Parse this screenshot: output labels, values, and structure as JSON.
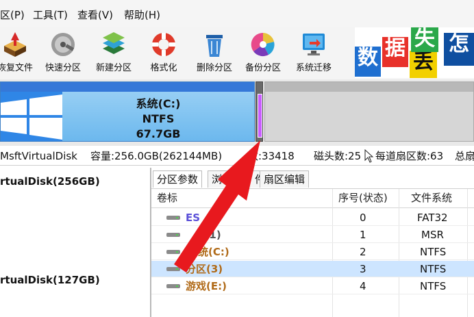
{
  "menu": {
    "items": [
      "区(P)",
      "工具(T)",
      "查看(V)",
      "帮助(H)"
    ]
  },
  "toolbar": {
    "items": [
      {
        "label": "恢复文件",
        "icon": "recover-icon"
      },
      {
        "label": "快速分区",
        "icon": "disk-icon"
      },
      {
        "label": "新建分区",
        "icon": "layers-icon"
      },
      {
        "label": "格式化",
        "icon": "lifebuoy-icon"
      },
      {
        "label": "删除分区",
        "icon": "trash-icon"
      },
      {
        "label": "备份分区",
        "icon": "pie-icon"
      },
      {
        "label": "系统迁移",
        "icon": "monitor-icon"
      }
    ]
  },
  "banner": {
    "chars": [
      "数",
      "据",
      "丢",
      "失",
      "怎"
    ]
  },
  "diskmap": {
    "partition_c": {
      "name": "系统(C:)",
      "fs": "NTFS",
      "size": "67.7GB"
    }
  },
  "disk_info": {
    "model": "MsftVirtualDisk",
    "capacity": "容量:256.0GB(262144MB)",
    "cylinders": "数:33418",
    "heads": "磁头数:25",
    "sectors": "每道扇区数:63",
    "total": "总扇"
  },
  "tree": {
    "items": [
      "rtualDisk(256GB)",
      "rtualDisk(127GB)"
    ]
  },
  "tabs": {
    "params": "分区参数",
    "browse": "浏",
    "files": "件",
    "sector_edit": "扇区编辑"
  },
  "table": {
    "headers": {
      "label": "卷标",
      "index": "序号(状态)",
      "fs": "文件系统"
    },
    "rows": [
      {
        "label": "ES",
        "label_tail": ")",
        "index": "0",
        "fs": "FAT32"
      },
      {
        "label": "",
        "label_tail": "R(1)",
        "index": "1",
        "fs": "MSR"
      },
      {
        "label": "",
        "label_tail": "系统(C:)",
        "index": "2",
        "fs": "NTFS"
      },
      {
        "label": "分区(3)",
        "label_tail": "",
        "index": "3",
        "fs": "NTFS"
      },
      {
        "label": "游戏(E:)",
        "label_tail": "",
        "index": "4",
        "fs": "NTFS"
      }
    ]
  },
  "colors": {
    "accent_red": "#e8191e",
    "selected_partition": "#c85cff",
    "volume_text": "#b06a18",
    "esp_text": "#5a4fd8"
  }
}
